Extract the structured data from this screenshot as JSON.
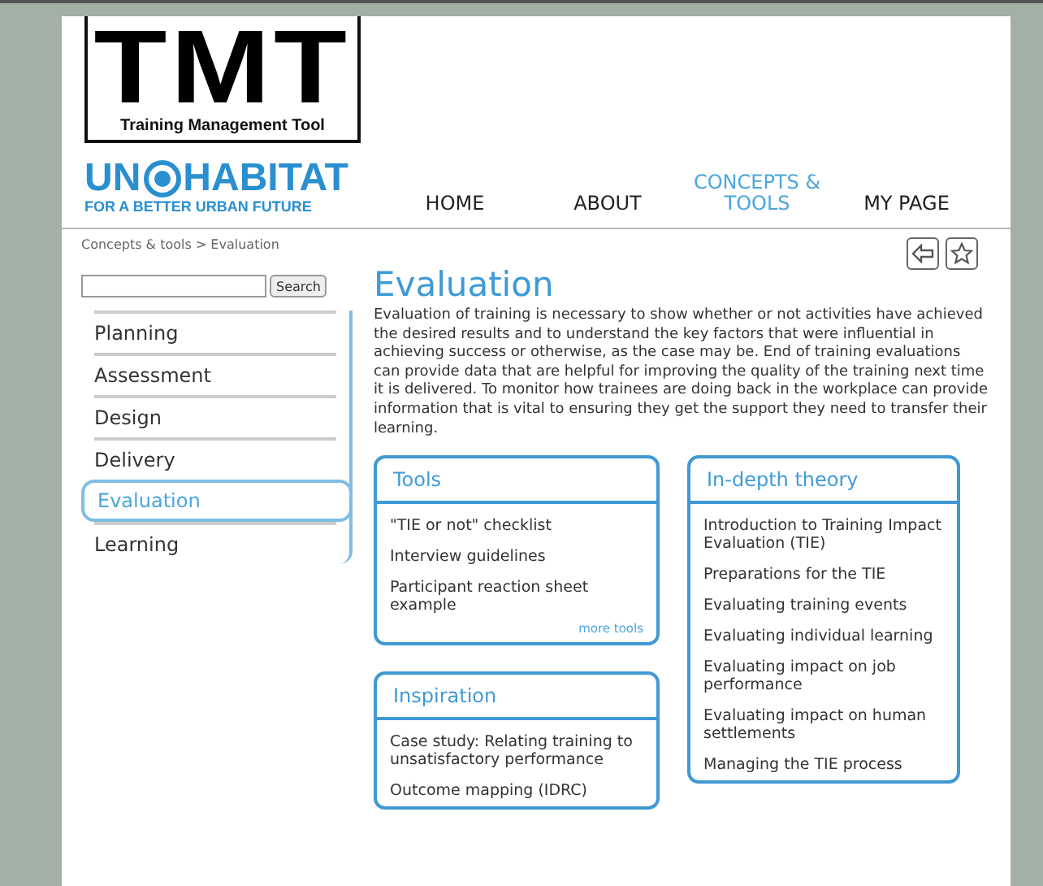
{
  "logo": {
    "title": "TMT",
    "subtitle": "Training Management Tool"
  },
  "brand": {
    "left": "UN",
    "right": "HABITAT",
    "tagline": "FOR A BETTER URBAN FUTURE"
  },
  "nav": [
    {
      "label": "HOME",
      "selected": false
    },
    {
      "label": "ABOUT",
      "selected": false
    },
    {
      "label": "CONCEPTS & TOOLS",
      "selected": true
    },
    {
      "label": "MY PAGE",
      "selected": false
    }
  ],
  "breadcrumb": "Concepts & tools > Evaluation",
  "search": {
    "button": "Search"
  },
  "sidebar": {
    "items": [
      {
        "label": "Planning",
        "selected": false
      },
      {
        "label": "Assessment",
        "selected": false
      },
      {
        "label": "Design",
        "selected": false
      },
      {
        "label": "Delivery",
        "selected": false
      },
      {
        "label": "Evaluation",
        "selected": true
      },
      {
        "label": "Learning",
        "selected": false
      }
    ]
  },
  "page": {
    "title": "Evaluation",
    "intro": "Evaluation of training is necessary to show whether or not activities have achieved the desired results and to understand the key factors that were influential in achieving success or otherwise, as the case may be. End of training evaluations can provide data that are helpful for improving the quality of the training next time it is delivered. To monitor how trainees are doing back in the workplace can provide information that is vital to ensuring they get the support they need to transfer their learning."
  },
  "panels": {
    "left": [
      {
        "title": "Tools",
        "items": [
          "\"TIE or not\" checklist",
          "Interview guidelines",
          "Participant reaction sheet example"
        ],
        "more": "more tools"
      },
      {
        "title": "Inspiration",
        "items": [
          "Case study: Relating training to unsatisfactory performance",
          "Outcome mapping (IDRC)"
        ]
      }
    ],
    "right": [
      {
        "title": "In-depth theory",
        "items": [
          "Introduction to Training Impact Evaluation (TIE)",
          "Preparations for the TIE",
          "Evaluating training events",
          "Evaluating individual learning",
          "Evaluating impact on job performance",
          "Evaluating impact on human settlements",
          "Managing the TIE process"
        ]
      }
    ]
  }
}
